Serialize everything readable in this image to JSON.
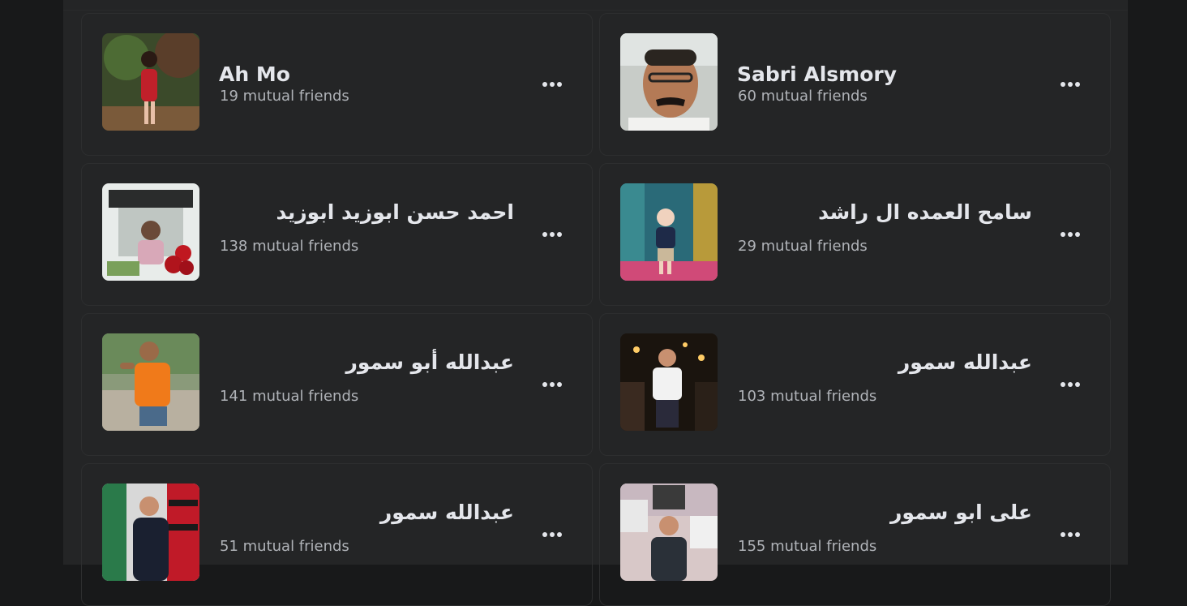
{
  "friends": [
    {
      "name": "Ah Mo",
      "mutual": "19 mutual friends",
      "rtl": false
    },
    {
      "name": "Sabri Alsmory",
      "mutual": "60 mutual friends",
      "rtl": false
    },
    {
      "name": "احمد حسن ابوزيد ابوزيد",
      "mutual": "138 mutual friends",
      "rtl": true
    },
    {
      "name": "سامح العمده ال راشد",
      "mutual": "29 mutual friends",
      "rtl": true
    },
    {
      "name": "عبدالله أبو سمور",
      "mutual": "141 mutual friends",
      "rtl": true
    },
    {
      "name": "عبدالله سمور",
      "mutual": "103 mutual friends",
      "rtl": true
    },
    {
      "name": "عبدالله سمور",
      "mutual": "51 mutual friends",
      "rtl": true
    },
    {
      "name": "على ابو سمور",
      "mutual": "155 mutual friends",
      "rtl": true
    }
  ],
  "icons": {
    "more": "more-horizontal-icon"
  },
  "colors": {
    "background": "#18191a",
    "panel": "#242526",
    "text": "#e4e6eb",
    "secondary": "#b0b3b8"
  }
}
